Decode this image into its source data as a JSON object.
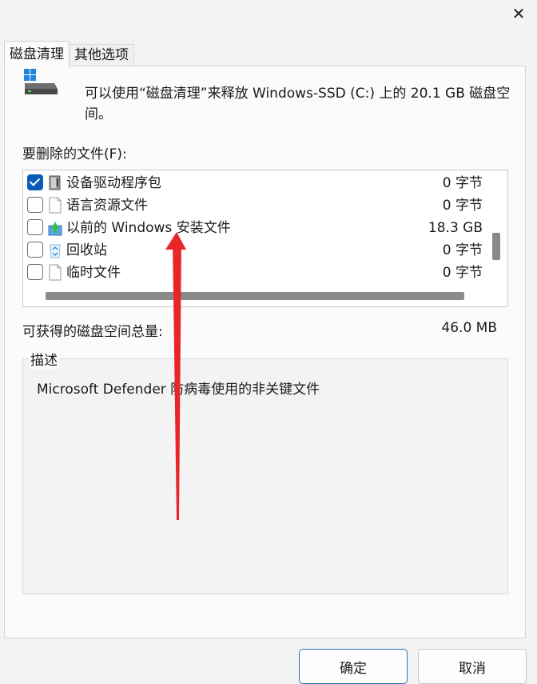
{
  "window": {
    "close_glyph": "✕"
  },
  "tabs": [
    {
      "label": "磁盘清理",
      "active": true
    },
    {
      "label": "其他选项",
      "active": false
    }
  ],
  "intro_text": "可以使用“磁盘清理”来释放 Windows-SSD (C:) 上的 20.1 GB 磁盘空间。",
  "files_label": "要删除的文件(F):",
  "files": [
    {
      "name": "设备驱动程序包",
      "size": "0 字节",
      "checked": true,
      "icon": "driver-package-icon"
    },
    {
      "name": "语言资源文件",
      "size": "0 字节",
      "checked": false,
      "icon": "file-icon"
    },
    {
      "name": "以前的 Windows 安装文件",
      "size": "18.3 GB",
      "checked": false,
      "icon": "windows-setup-icon"
    },
    {
      "name": "回收站",
      "size": "0 字节",
      "checked": false,
      "icon": "recycle-bin-icon"
    },
    {
      "name": "临时文件",
      "size": "0 字节",
      "checked": false,
      "icon": "file-icon"
    }
  ],
  "total_label": "可获得的磁盘空间总量:",
  "total_value": "46.0 MB",
  "description": {
    "legend": "描述",
    "text": "Microsoft Defender 防病毒使用的非关键文件"
  },
  "buttons": {
    "ok": "确定",
    "cancel": "取消"
  },
  "colors": {
    "accent": "#0b5cb8",
    "arrow": "#e8262a"
  }
}
